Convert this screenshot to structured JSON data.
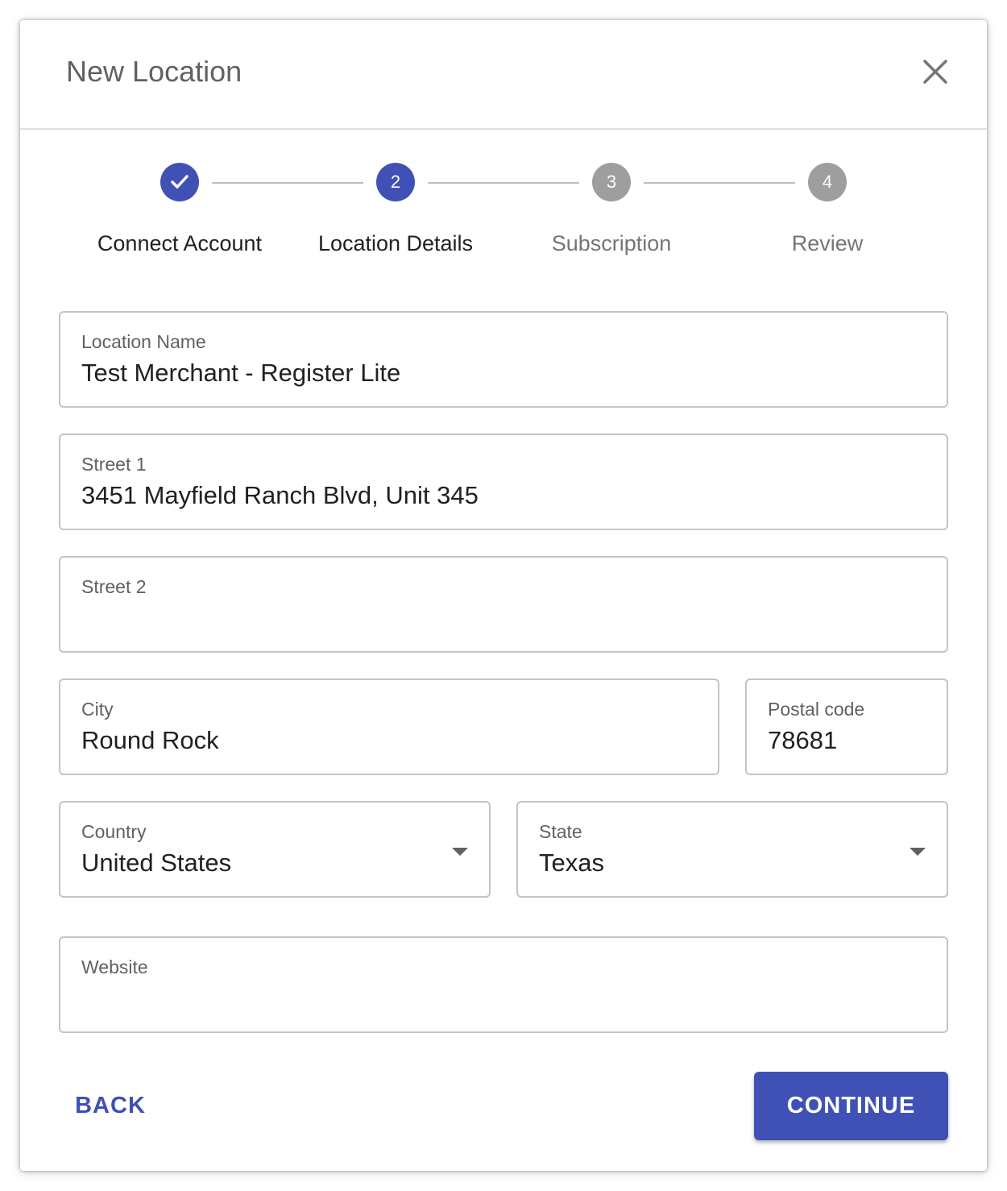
{
  "dialog": {
    "title": "New Location",
    "close_icon": "close-icon"
  },
  "stepper": {
    "steps": [
      {
        "number": "1",
        "label": "Connect Account",
        "status": "completed",
        "icon": "check-icon"
      },
      {
        "number": "2",
        "label": "Location Details",
        "status": "active"
      },
      {
        "number": "3",
        "label": "Subscription",
        "status": "pending"
      },
      {
        "number": "4",
        "label": "Review",
        "status": "pending"
      }
    ]
  },
  "form": {
    "location_name": {
      "label": "Location Name",
      "value": "Test Merchant - Register Lite"
    },
    "street1": {
      "label": "Street 1",
      "value": "3451 Mayfield Ranch Blvd, Unit 345"
    },
    "street2": {
      "label": "Street 2",
      "value": ""
    },
    "city": {
      "label": "City",
      "value": "Round Rock"
    },
    "postal_code": {
      "label": "Postal code",
      "value": "78681"
    },
    "country": {
      "label": "Country",
      "value": "United States"
    },
    "state": {
      "label": "State",
      "value": "Texas"
    },
    "website": {
      "label": "Website",
      "value": ""
    }
  },
  "footer": {
    "back_label": "BACK",
    "continue_label": "CONTINUE"
  },
  "colors": {
    "primary": "#3f51b5",
    "inactive_step": "#9e9e9e"
  }
}
